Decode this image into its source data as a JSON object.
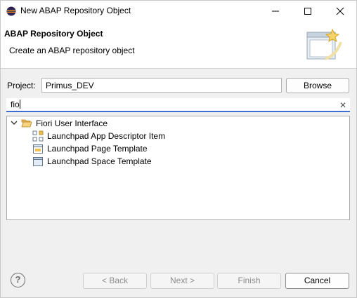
{
  "window": {
    "title": "New ABAP Repository Object"
  },
  "header": {
    "title": "ABAP Repository Object",
    "description": "Create an ABAP repository object"
  },
  "project": {
    "label": "Project:",
    "value": "Primus_DEV",
    "browse_label": "Browse"
  },
  "filter": {
    "value": "fio"
  },
  "tree": {
    "category": {
      "label": "Fiori User Interface",
      "icon": "folder-open-icon",
      "expanded": true
    },
    "items": [
      {
        "label": "Launchpad App Descriptor Item",
        "icon": "app-descriptor-icon"
      },
      {
        "label": "Launchpad Page Template",
        "icon": "page-template-icon"
      },
      {
        "label": "Launchpad Space Template",
        "icon": "space-template-icon"
      }
    ]
  },
  "footer": {
    "help": "?",
    "back_label": "< Back",
    "next_label": "Next >",
    "finish_label": "Finish",
    "cancel_label": "Cancel"
  },
  "colors": {
    "accent": "#3c6ed1",
    "folder": "#e8b64c",
    "eclipse_purple": "#2c2255"
  }
}
